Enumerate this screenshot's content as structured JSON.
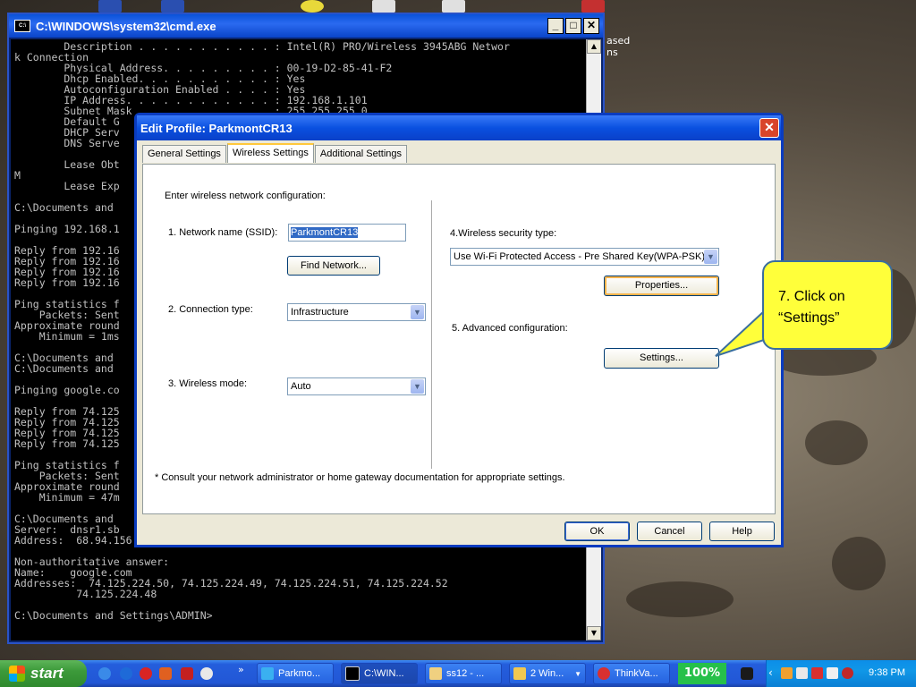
{
  "desktop": {
    "side_text_1": "ased",
    "side_text_2": "ns"
  },
  "cmd": {
    "title": "C:\\WINDOWS\\system32\\cmd.exe",
    "icon": "cmd-icon",
    "minimize": "_",
    "maximize": "□",
    "close": "✕",
    "output": "        Description . . . . . . . . . . . : Intel(R) PRO/Wireless 3945ABG Networ\nk Connection\n        Physical Address. . . . . . . . . : 00-19-D2-85-41-F2\n        Dhcp Enabled. . . . . . . . . . . : Yes\n        Autoconfiguration Enabled . . . . : Yes\n        IP Address. . . . . . . . . . . . : 192.168.1.101\n        Subnet Mask . . . . . . . . . . . : 255.255.255.0\n        Default G\n        DHCP Serv\n        DNS Serve\n\n        Lease Obt\nM\n        Lease Exp\n\nC:\\Documents and\n\nPinging 192.168.1\n\nReply from 192.16\nReply from 192.16\nReply from 192.16\nReply from 192.16\n\nPing statistics f\n    Packets: Sent\nApproximate round\n    Minimum = 1ms\n\nC:\\Documents and\nC:\\Documents and\n\nPinging google.co\n\nReply from 74.125\nReply from 74.125\nReply from 74.125\nReply from 74.125\n\nPing statistics f\n    Packets: Sent\nApproximate round\n    Minimum = 47m\n\nC:\\Documents and\nServer:  dnsr1.sb\nAddress:  68.94.156.1\n\nNon-authoritative answer:\nName:    google.com\nAddresses:  74.125.224.50, 74.125.224.49, 74.125.224.51, 74.125.224.52\n          74.125.224.48\n\nC:\\Documents and Settings\\ADMIN>"
  },
  "dialog": {
    "title": "Edit Profile: ParkmontCR13",
    "close": "✕",
    "tabs": [
      {
        "label": "General Settings"
      },
      {
        "label": "Wireless Settings",
        "active": true
      },
      {
        "label": "Additional Settings"
      }
    ],
    "intro": "Enter wireless network configuration:",
    "ssid_label": "1. Network name (SSID):",
    "ssid_value": "ParkmontCR13",
    "find_network": "Find Network...",
    "connection_label": "2. Connection type:",
    "connection_value": "Infrastructure",
    "mode_label": "3. Wireless mode:",
    "mode_value": "Auto",
    "security_label": "4.Wireless security type:",
    "security_value": "Use Wi-Fi Protected Access - Pre Shared Key(WPA-PSK)",
    "properties": "Properties...",
    "advanced_label": "5. Advanced configuration:",
    "settings": "Settings...",
    "footnote": "* Consult your network administrator or home gateway documentation for appropriate settings.",
    "ok": "OK",
    "cancel": "Cancel",
    "help": "Help"
  },
  "callout": {
    "line1": "7. Click on",
    "line2": "“Settings”"
  },
  "taskbar": {
    "start": "start",
    "chevron": "»",
    "tasks": [
      {
        "label": "Parkmo...",
        "icon": "network-icon"
      },
      {
        "label": "C:\\WIN...",
        "icon": "cmd-icon",
        "active": true
      },
      {
        "label": "ss12 - ...",
        "icon": "paint-icon"
      },
      {
        "label": "2 Win...",
        "icon": "folder-icon"
      },
      {
        "label": "ThinkVa...",
        "icon": "thinkvantage-icon"
      }
    ],
    "zoom": "100%",
    "clock": "9:38 PM"
  }
}
